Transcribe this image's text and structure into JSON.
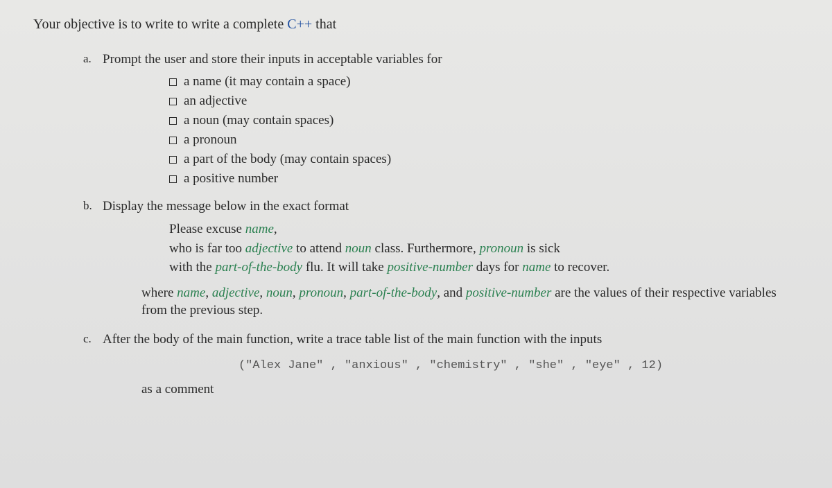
{
  "intro_prefix": "Your objective is to write to write a complete ",
  "intro_lang": "C++",
  "intro_suffix": " that",
  "items": {
    "a": {
      "letter": "a.",
      "text": "Prompt the user and store their inputs in acceptable variables for",
      "checklist": [
        {
          "pre": "a name ",
          "paren": "(it may contain a space)"
        },
        {
          "pre": "an adjective",
          "paren": ""
        },
        {
          "pre": "a noun ",
          "paren": "(may contain spaces)"
        },
        {
          "pre": "a pronoun",
          "paren": ""
        },
        {
          "pre": "a part of the body ",
          "paren": "(may contain spaces)"
        },
        {
          "pre": "a positive number",
          "paren": ""
        }
      ]
    },
    "b": {
      "letter": "b.",
      "text": "Display the message below in the exact format",
      "message": {
        "line1_pre": "Please excuse ",
        "name": "name",
        "line1_post": ",",
        "line2_pre": "who is far too ",
        "adjective": "adjective",
        "line2_mid1": " to attend ",
        "noun": "noun",
        "line2_mid2": " class. Furthermore, ",
        "pronoun": "pronoun",
        "line2_post": " is sick",
        "line3_pre": "with the ",
        "partbody": "part-of-the-body",
        "line3_mid1": " flu. It will take ",
        "posnum": "positive-number",
        "line3_mid2": " days for ",
        "name2": "name",
        "line3_post": " to recover."
      },
      "where": {
        "pre": "where ",
        "v1": "name",
        "s1": ", ",
        "v2": "adjective",
        "s2": ", ",
        "v3": "noun",
        "s3": ", ",
        "v4": "pronoun",
        "s4": ", ",
        "v5": "part-of-the-body",
        "s5": ", and ",
        "v6": "positive-number",
        "post": " are the values of their respective variables from the previous step."
      }
    },
    "c": {
      "letter": "c.",
      "text": "After the body of the main function, write a trace table list of the main function with the inputs",
      "code": "(\"Alex Jane\" , \"anxious\" , \"chemistry\" , \"she\" , \"eye\" , 12)",
      "as_comment": "as a comment"
    }
  }
}
